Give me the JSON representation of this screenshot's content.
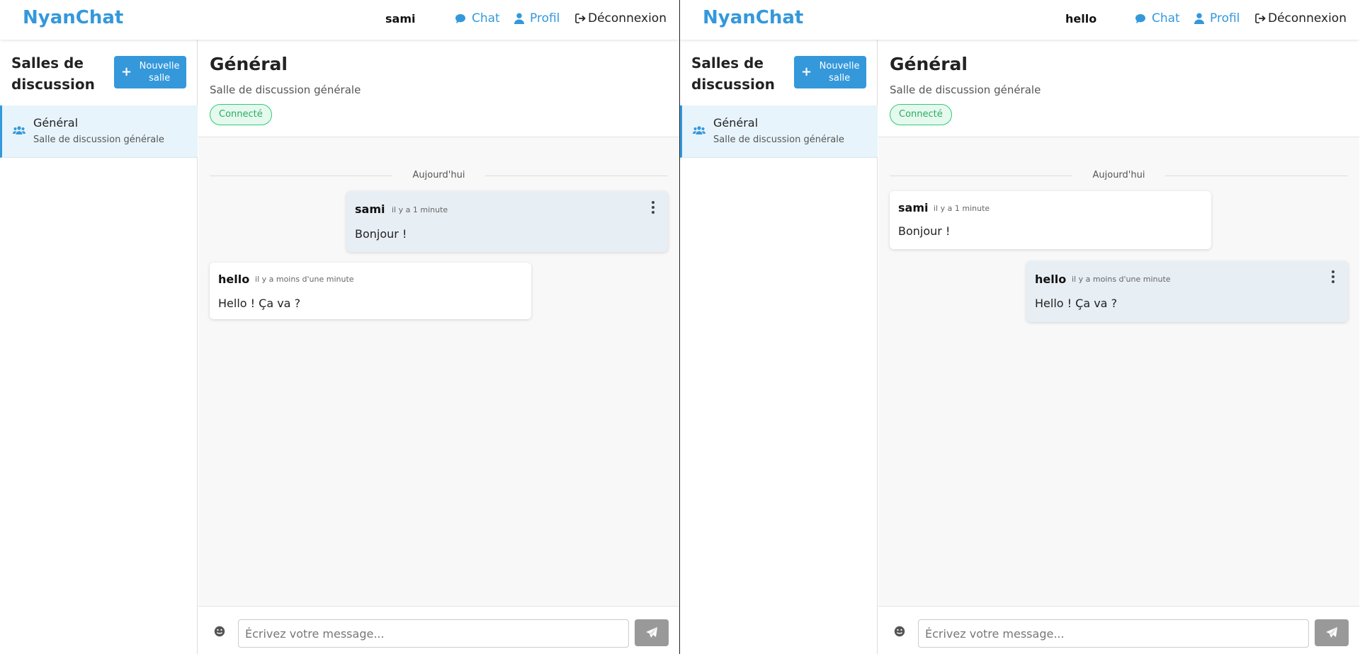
{
  "colors": {
    "accent": "#3498db",
    "status_green": "#27ae60",
    "own_message_bg": "#e7eef4",
    "send_disabled": "#999999"
  },
  "panes": [
    {
      "nav": {
        "brand": "NyanChat",
        "username": "sami",
        "chat_label": "Chat",
        "profile_label": "Profil",
        "logout_label": "Déconnexion"
      },
      "sidebar": {
        "title": "Salles de discussion",
        "new_room_label": "Nouvelle salle",
        "rooms": [
          {
            "name": "Général",
            "description": "Salle de discussion générale",
            "icon": "users-icon"
          }
        ]
      },
      "chat": {
        "title": "Général",
        "subtitle": "Salle de discussion générale",
        "status": "Connecté",
        "day_separator": "Aujourd'hui",
        "messages": [
          {
            "author": "sami",
            "time": "il y a 1 minute",
            "text": "Bonjour !",
            "own": true
          },
          {
            "author": "hello",
            "time": "il y a moins d'une minute",
            "text": "Hello ! Ça va ?",
            "own": false
          }
        ],
        "composer": {
          "placeholder": "Écrivez votre message..."
        }
      }
    },
    {
      "nav": {
        "brand": "NyanChat",
        "username": "hello",
        "chat_label": "Chat",
        "profile_label": "Profil",
        "logout_label": "Déconnexion"
      },
      "sidebar": {
        "title": "Salles de discussion",
        "new_room_label": "Nouvelle salle",
        "rooms": [
          {
            "name": "Général",
            "description": "Salle de discussion générale",
            "icon": "users-icon"
          }
        ]
      },
      "chat": {
        "title": "Général",
        "subtitle": "Salle de discussion générale",
        "status": "Connecté",
        "day_separator": "Aujourd'hui",
        "messages": [
          {
            "author": "sami",
            "time": "il y a 1 minute",
            "text": "Bonjour !",
            "own": false
          },
          {
            "author": "hello",
            "time": "il y a moins d'une minute",
            "text": "Hello ! Ça va ?",
            "own": true
          }
        ],
        "composer": {
          "placeholder": "Écrivez votre message..."
        }
      }
    }
  ]
}
